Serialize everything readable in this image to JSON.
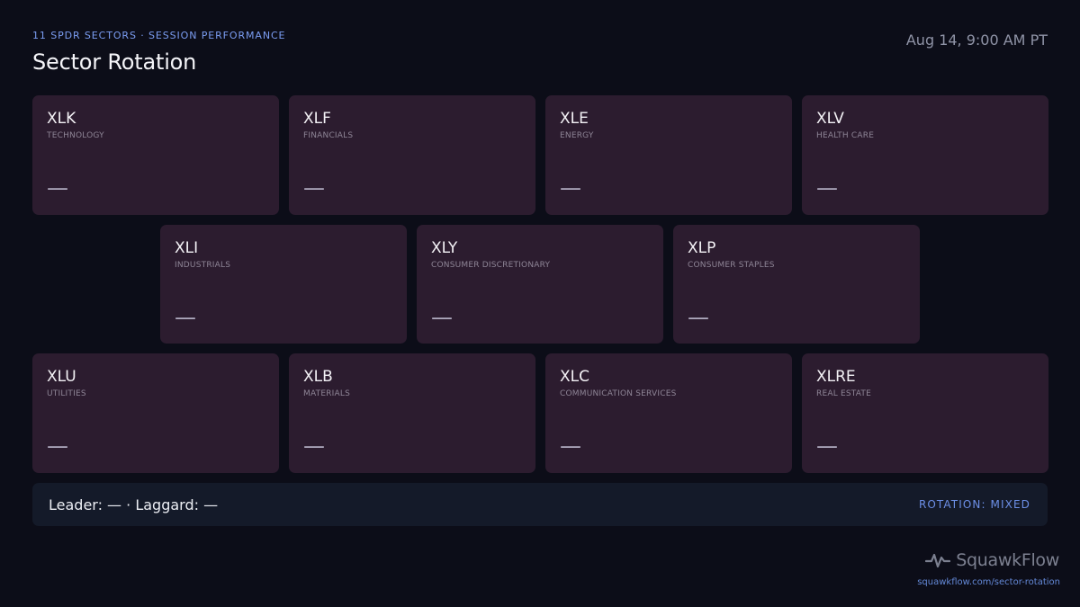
{
  "header": {
    "eyebrow": "11 SPDR SECTORS · SESSION PERFORMANCE",
    "title": "Sector Rotation",
    "timestamp": "Aug 14, 9:00 AM PT"
  },
  "tiles": [
    {
      "ticker": "XLK",
      "sector": "TECHNOLOGY",
      "change": "—"
    },
    {
      "ticker": "XLF",
      "sector": "FINANCIALS",
      "change": "—"
    },
    {
      "ticker": "XLE",
      "sector": "ENERGY",
      "change": "—"
    },
    {
      "ticker": "XLV",
      "sector": "HEALTH CARE",
      "change": "—"
    },
    {
      "ticker": "XLI",
      "sector": "INDUSTRIALS",
      "change": "—"
    },
    {
      "ticker": "XLY",
      "sector": "CONSUMER DISCRETIONARY",
      "change": "—"
    },
    {
      "ticker": "XLP",
      "sector": "CONSUMER STAPLES",
      "change": "—"
    },
    {
      "ticker": "XLU",
      "sector": "UTILITIES",
      "change": "—"
    },
    {
      "ticker": "XLB",
      "sector": "MATERIALS",
      "change": "—"
    },
    {
      "ticker": "XLC",
      "sector": "COMMUNICATION SERVICES",
      "change": "—"
    },
    {
      "ticker": "XLRE",
      "sector": "REAL ESTATE",
      "change": "—"
    }
  ],
  "summary": {
    "leaders": "Leader: — · Laggard: —",
    "rotation": "ROTATION: MIXED"
  },
  "brand": {
    "icon": "pulse-icon",
    "name": "SquawkFlow",
    "url": "squawkflow.com/sector-rotation"
  },
  "colors": {
    "background": "#0c0d18",
    "tile": "#2c1c2f",
    "accent": "#7b9df2",
    "summary_bar": "#141a29"
  }
}
